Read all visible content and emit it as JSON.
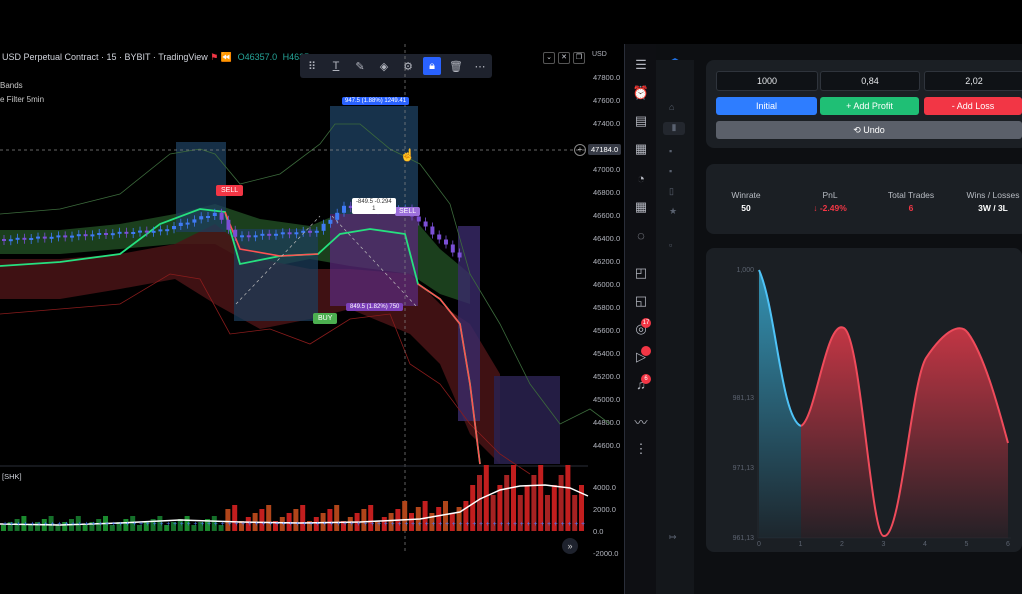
{
  "tv": {
    "symbol_line": "USD Perpetual Contract · 15 · BYBIT · TradingView",
    "ohlc_o": "O46357.0",
    "ohlc_h": "H4635",
    "ind1": "Bands",
    "ind2": "e Filter 5min",
    "currency": "USD",
    "sub_pane_label": "[SHK]",
    "crosshair_price": "47184.0",
    "price_ticks": [
      "47800.0",
      "47600.0",
      "47400.0",
      "47200.0",
      "47000.0",
      "46800.0",
      "46600.0",
      "46400.0",
      "46200.0",
      "46000.0",
      "45800.0",
      "45600.0",
      "45400.0",
      "45200.0",
      "45000.0",
      "44800.0",
      "44600.0"
    ],
    "vol_ticks": [
      "4000.0",
      "2000.0",
      "0.0",
      "-2000.0"
    ],
    "sell_tag": "SELL",
    "buy_tag": "BUY",
    "sell_tag2": "SELL",
    "top_box_label": "947.5 (1.88%) 1249.41",
    "mid_box_label": "-849.5 -0.294",
    "mid_box_label2": "1",
    "bottom_box_label": "849.5 (1.82%) 750",
    "toolbar_icons": [
      "layout-icon",
      "text-icon",
      "brush-icon",
      "fill-icon",
      "settings-icon",
      "lock-icon",
      "trash-icon",
      "more-icon"
    ]
  },
  "rail": {
    "badges": [
      "17",
      "",
      "6"
    ]
  },
  "app": {
    "inputs": [
      "1000",
      "0,84",
      "2,02"
    ],
    "buttons": {
      "initial": "Initial",
      "add_profit": "+ Add Profit",
      "add_loss": "- Add Loss",
      "undo": "⟲ Undo"
    },
    "stats": [
      {
        "label": "Winrate",
        "value": "50",
        "color": "#ffffff"
      },
      {
        "label": "PnL",
        "value": "↓ -2.49%",
        "color": "#f23645"
      },
      {
        "label": "Total Trades",
        "value": "6",
        "color": "#f23645"
      },
      {
        "label": "Wins / Losses",
        "value": "3W / 3L",
        "color": "#ffffff"
      }
    ],
    "pnl_chart": {
      "yticks": [
        "1,000",
        "981,13",
        "971,13",
        "961,13"
      ],
      "xticks": [
        "0",
        "1",
        "2",
        "3",
        "4",
        "5",
        "6"
      ]
    }
  },
  "colors": {
    "blue": "#2979ff",
    "green": "#1fbf75",
    "red": "#f23645",
    "grey": "#5b606a"
  }
}
